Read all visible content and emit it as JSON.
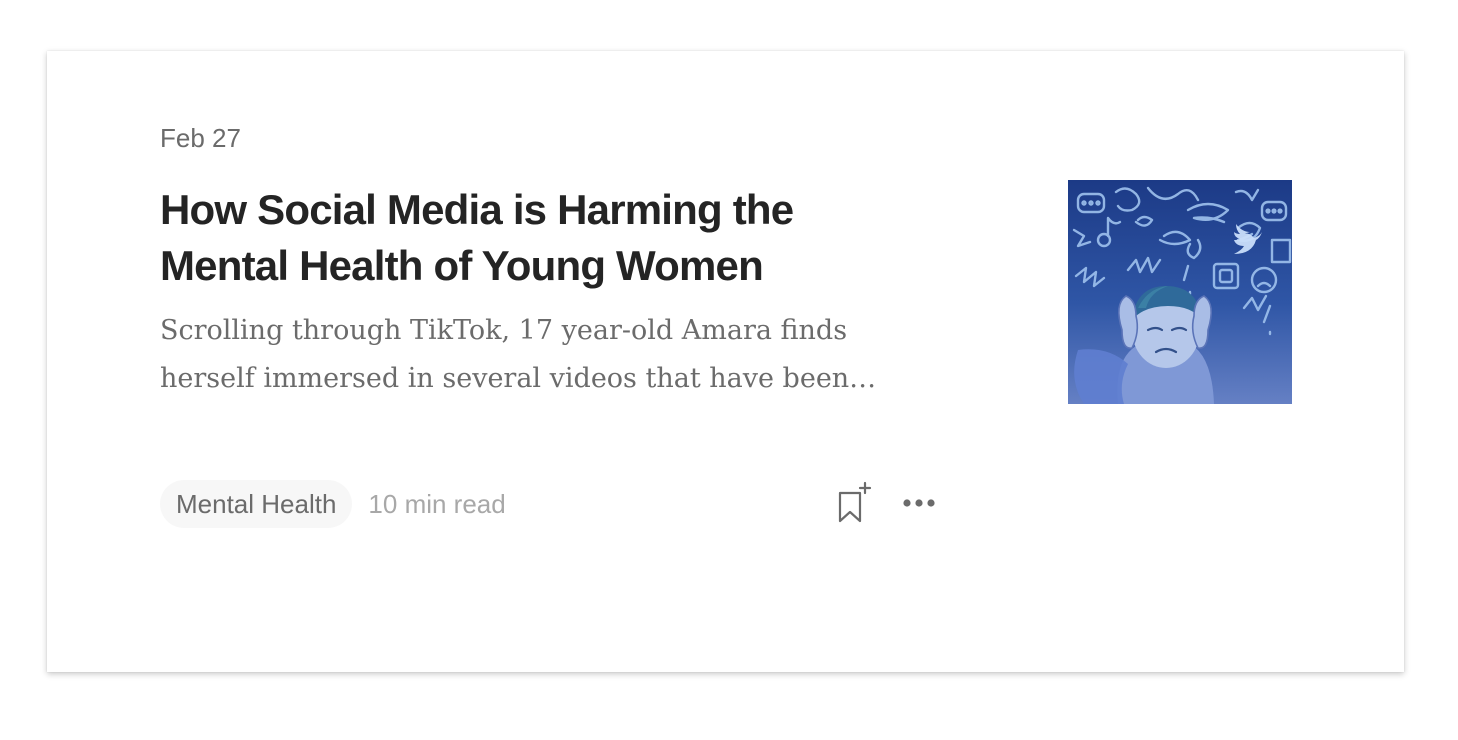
{
  "post": {
    "date": "Feb 27",
    "title": "How Social Media is Harming the Mental Health of Young Women",
    "excerpt": "Scrolling through TikTok, 17 year-old Amara finds herself immersed in several videos that have been…",
    "tag": "Mental Health",
    "read_time": "10 min read"
  },
  "icons": {
    "bookmark": "bookmark-add-icon",
    "more": "more-options-icon"
  },
  "colors": {
    "title": "#242424",
    "meta": "#6b6b6b",
    "muted": "#a8a8a8",
    "tag_bg": "#f7f7f7",
    "thumb_dark": "#1f3f8a",
    "thumb_light": "#6f86c8"
  }
}
